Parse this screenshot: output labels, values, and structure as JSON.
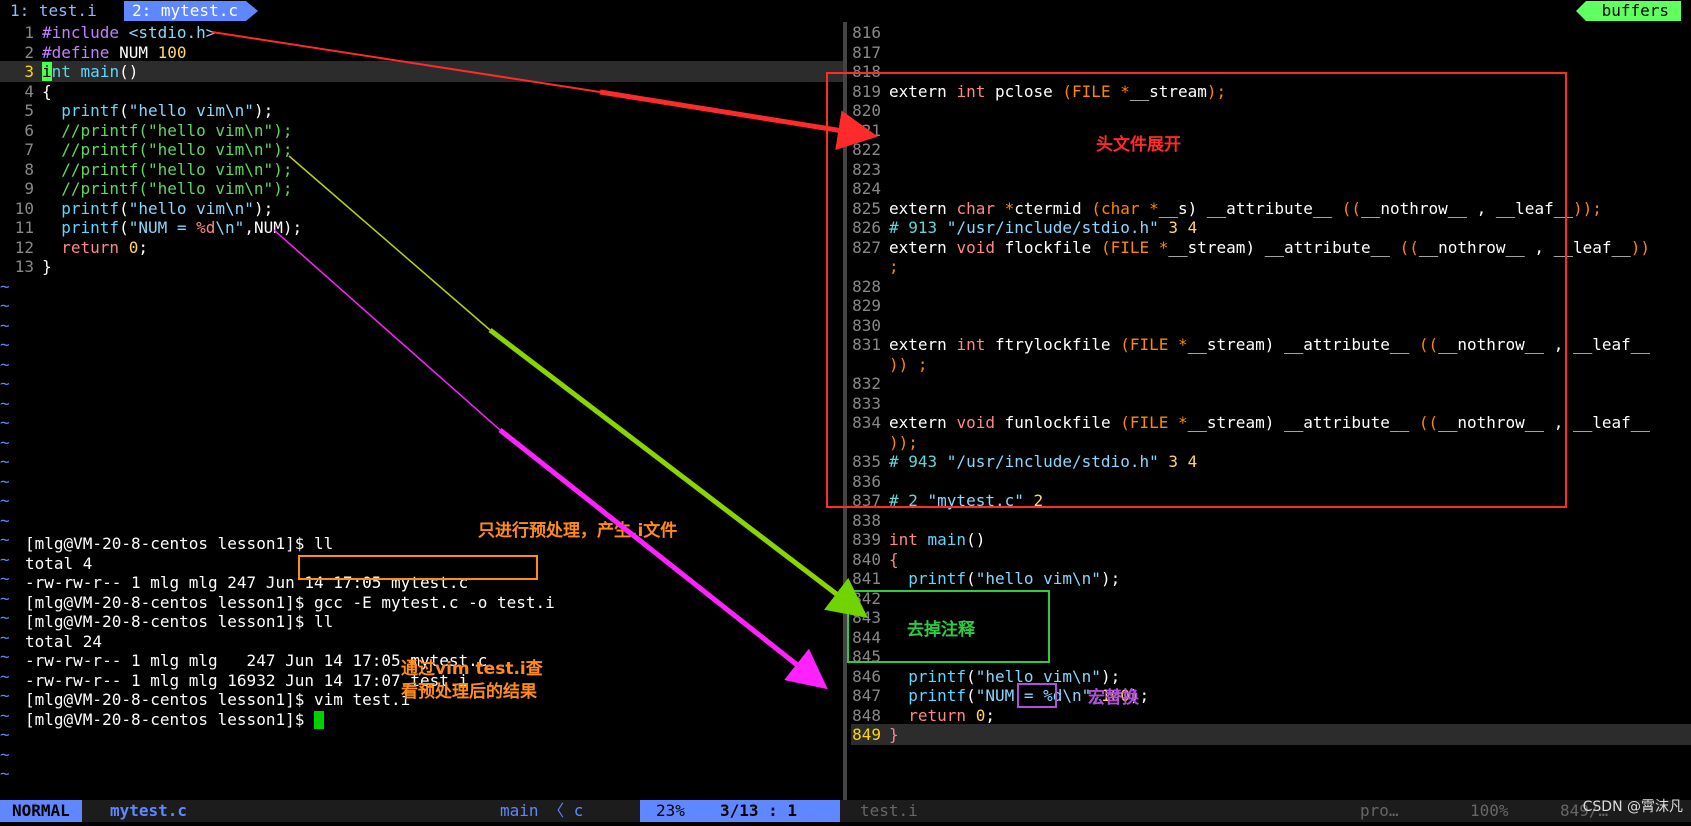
{
  "tabs": [
    {
      "label": "1: test.i"
    },
    {
      "label": "2: mytest.c"
    }
  ],
  "buffers_label": "buffers",
  "left_code": [
    {
      "n": "1",
      "parts": [
        [
          "c-pre",
          "#include "
        ],
        [
          "c-inc",
          "<stdio.h>"
        ]
      ]
    },
    {
      "n": "2",
      "parts": [
        [
          "c-pre",
          "#define "
        ],
        [
          "",
          "NUM "
        ],
        [
          "c-num",
          "100"
        ]
      ]
    },
    {
      "n": "3",
      "parts": [
        [
          "cursor",
          "i"
        ],
        [
          "c-type",
          "nt "
        ],
        [
          "c-fn",
          "main"
        ],
        [
          "",
          "()"
        ]
      ],
      "current": true
    },
    {
      "n": "4",
      "parts": [
        [
          "",
          "{"
        ]
      ]
    },
    {
      "n": "5",
      "parts": [
        [
          "",
          "  "
        ],
        [
          "c-fn",
          "printf"
        ],
        [
          "",
          "("
        ],
        [
          "c-str",
          "\"hello vim\\n\""
        ],
        [
          "",
          ");"
        ]
      ]
    },
    {
      "n": "6",
      "parts": [
        [
          "c-cmt",
          "  //printf(\"hello vim\\n\");"
        ]
      ]
    },
    {
      "n": "7",
      "parts": [
        [
          "c-cmt",
          "  //printf(\"hello vim\\n\");"
        ]
      ]
    },
    {
      "n": "8",
      "parts": [
        [
          "c-cmt",
          "  //printf(\"hello vim\\n\");"
        ]
      ]
    },
    {
      "n": "9",
      "parts": [
        [
          "c-cmt",
          "  //printf(\"hello vim\\n\");"
        ]
      ]
    },
    {
      "n": "10",
      "parts": [
        [
          "",
          "  "
        ],
        [
          "c-fn",
          "printf"
        ],
        [
          "",
          "("
        ],
        [
          "c-str",
          "\"hello vim\\n\""
        ],
        [
          "",
          ");"
        ]
      ]
    },
    {
      "n": "11",
      "parts": [
        [
          "",
          "  "
        ],
        [
          "c-fn",
          "printf"
        ],
        [
          "",
          "("
        ],
        [
          "c-str",
          "\"NUM = "
        ],
        [
          "c-kw",
          "%d"
        ],
        [
          "c-str",
          "\\n\""
        ],
        [
          "",
          ",NUM);"
        ]
      ]
    },
    {
      "n": "12",
      "parts": [
        [
          "",
          "  "
        ],
        [
          "c-kw",
          "return "
        ],
        [
          "c-num",
          "0"
        ],
        [
          "",
          ";"
        ]
      ]
    },
    {
      "n": "13",
      "parts": [
        [
          "",
          "}"
        ]
      ]
    }
  ],
  "right_code": [
    {
      "n": "816",
      "parts": []
    },
    {
      "n": "817",
      "parts": []
    },
    {
      "n": "818",
      "parts": []
    },
    {
      "n": "819",
      "parts": [
        [
          "",
          "extern "
        ],
        [
          "c-kw",
          "int "
        ],
        [
          "",
          "pclose "
        ],
        [
          "c-orange",
          "(FILE *"
        ],
        [
          "",
          "__stream"
        ],
        [
          "c-orange",
          ");"
        ]
      ]
    },
    {
      "n": "820",
      "parts": []
    },
    {
      "n": "821",
      "parts": []
    },
    {
      "n": "822",
      "parts": []
    },
    {
      "n": "823",
      "parts": []
    },
    {
      "n": "824",
      "parts": []
    },
    {
      "n": "825",
      "parts": [
        [
          "",
          "extern "
        ],
        [
          "c-kw",
          "char "
        ],
        [
          "c-orange",
          "*"
        ],
        [
          "",
          "ctermid "
        ],
        [
          "c-orange",
          "(char *"
        ],
        [
          "",
          "__s) __attribute__ "
        ],
        [
          "c-orange",
          "(("
        ],
        [
          "",
          "__nothrow__ , __leaf__"
        ],
        [
          "c-orange",
          "));"
        ]
      ]
    },
    {
      "n": "826",
      "parts": [
        [
          "c-hash",
          "# 913 "
        ],
        [
          "c-str",
          "\"/usr/include/stdio.h\" "
        ],
        [
          "c-num",
          "3 4"
        ]
      ]
    },
    {
      "n": "827",
      "parts": [
        [
          "",
          "extern "
        ],
        [
          "c-kw",
          "void "
        ],
        [
          "",
          "flockfile "
        ],
        [
          "c-orange",
          "(FILE *"
        ],
        [
          "",
          "__stream) __attribute__ "
        ],
        [
          "c-orange",
          "(("
        ],
        [
          "",
          "__nothrow__ , __leaf__"
        ],
        [
          "c-orange",
          "))"
        ]
      ]
    },
    {
      "n": "",
      "parts": [
        [
          "c-orange",
          ";"
        ]
      ]
    },
    {
      "n": "828",
      "parts": []
    },
    {
      "n": "829",
      "parts": []
    },
    {
      "n": "830",
      "parts": []
    },
    {
      "n": "831",
      "parts": [
        [
          "",
          "extern "
        ],
        [
          "c-kw",
          "int "
        ],
        [
          "",
          "ftrylockfile "
        ],
        [
          "c-orange",
          "(FILE *"
        ],
        [
          "",
          "__stream) __attribute__ "
        ],
        [
          "c-orange",
          "(("
        ],
        [
          "",
          "__nothrow__ , __leaf__"
        ]
      ]
    },
    {
      "n": "",
      "parts": [
        [
          "c-orange",
          ")) ;"
        ]
      ]
    },
    {
      "n": "832",
      "parts": []
    },
    {
      "n": "833",
      "parts": []
    },
    {
      "n": "834",
      "parts": [
        [
          "",
          "extern "
        ],
        [
          "c-kw",
          "void "
        ],
        [
          "",
          "funlockfile "
        ],
        [
          "c-orange",
          "(FILE *"
        ],
        [
          "",
          "__stream) __attribute__ "
        ],
        [
          "c-orange",
          "(("
        ],
        [
          "",
          "__nothrow__ , __leaf__"
        ]
      ]
    },
    {
      "n": "",
      "parts": [
        [
          "c-orange",
          "));"
        ]
      ]
    },
    {
      "n": "835",
      "parts": [
        [
          "c-hash",
          "# 943 "
        ],
        [
          "c-str",
          "\"/usr/include/stdio.h\" "
        ],
        [
          "c-num",
          "3 4"
        ]
      ]
    },
    {
      "n": "836",
      "parts": []
    },
    {
      "n": "837",
      "parts": [
        [
          "c-hash",
          "# 2 "
        ],
        [
          "c-str",
          "\"mytest.c\" "
        ],
        [
          "c-num",
          "2"
        ]
      ]
    },
    {
      "n": "838",
      "parts": []
    },
    {
      "n": "839",
      "parts": [
        [
          "c-kw",
          "int "
        ],
        [
          "c-fn",
          "main"
        ],
        [
          "",
          "()"
        ]
      ]
    },
    {
      "n": "840",
      "parts": [
        [
          "c-kw",
          "{"
        ]
      ]
    },
    {
      "n": "841",
      "parts": [
        [
          "",
          "  "
        ],
        [
          "c-fn",
          "printf"
        ],
        [
          "",
          "("
        ],
        [
          "c-str",
          "\"hello vim\\n\""
        ],
        [
          "",
          ");"
        ]
      ]
    },
    {
      "n": "842",
      "parts": []
    },
    {
      "n": "843",
      "parts": []
    },
    {
      "n": "844",
      "parts": []
    },
    {
      "n": "845",
      "parts": []
    },
    {
      "n": "846",
      "parts": [
        [
          "",
          "  "
        ],
        [
          "c-fn",
          "printf"
        ],
        [
          "",
          "("
        ],
        [
          "c-str",
          "\"hello vim\\n\""
        ],
        [
          "",
          ");"
        ]
      ]
    },
    {
      "n": "847",
      "parts": [
        [
          "",
          "  "
        ],
        [
          "c-fn",
          "printf"
        ],
        [
          "",
          "("
        ],
        [
          "c-str",
          "\"NUM = %d\\n\""
        ],
        [
          "",
          ","
        ],
        [
          "c-num",
          "100"
        ],
        [
          "",
          ");"
        ]
      ]
    },
    {
      "n": "848",
      "parts": [
        [
          "",
          "  "
        ],
        [
          "c-kw",
          "return "
        ],
        [
          "c-num",
          "0"
        ],
        [
          "",
          ";"
        ]
      ]
    },
    {
      "n": "849",
      "parts": [
        [
          "c-kw",
          "}"
        ]
      ],
      "current": true
    }
  ],
  "terminal": [
    "[mlg@VM-20-8-centos lesson1]$ ll",
    "total 4",
    "-rw-rw-r-- 1 mlg mlg 247 Jun 14 17:05 mytest.c",
    "[mlg@VM-20-8-centos lesson1]$ gcc -E mytest.c -o test.i",
    "[mlg@VM-20-8-centos lesson1]$ ll",
    "total 24",
    "-rw-rw-r-- 1 mlg mlg   247 Jun 14 17:05 mytest.c",
    "-rw-rw-r-- 1 mlg mlg 16932 Jun 14 17:07 test.i",
    "[mlg@VM-20-8-centos lesson1]$ vim test.i",
    "[mlg@VM-20-8-centos lesson1]$ "
  ],
  "notes": {
    "header_expand": "头文件展开",
    "preprocess_only": "只进行预处理，产生.i文件",
    "remove_comments": "去掉注释",
    "macro_replace": "宏替换",
    "view_line1": "通过vim test.i查",
    "view_line2": "看预处理后的结果"
  },
  "status": {
    "mode": "NORMAL",
    "file": "mytest.c",
    "function": "main 〈 c",
    "percent": "23%",
    "position": "3/13 :  1",
    "right_file": "test.i",
    "right_pro": "pro…",
    "right_percent": "100%",
    "right_position": "849/…"
  },
  "watermark": "CSDN @霄沫凡",
  "colors": {
    "red_annotation": "#ff2a2a",
    "green_annotation": "#2ecc40",
    "magenta_annotation": "#ff22ff",
    "orange_annotation": "#ff8c1a",
    "purple_annotation": "#b04fd8",
    "blue_mode": "#5f87ff"
  }
}
